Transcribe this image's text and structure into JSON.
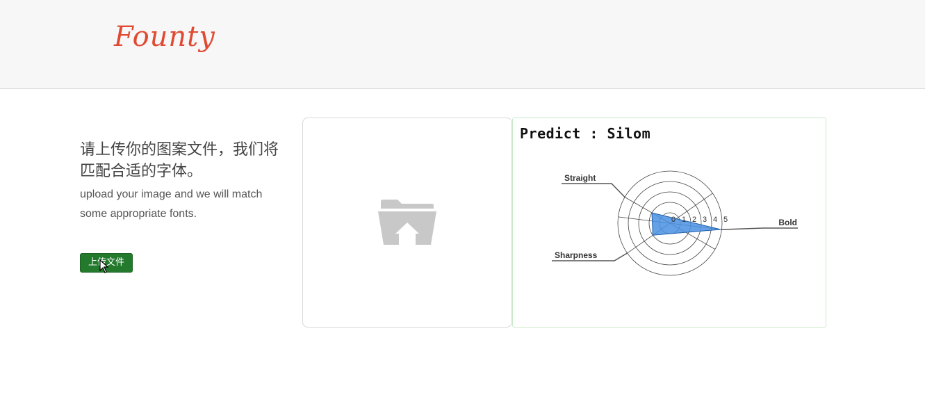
{
  "header": {
    "logo": "Founty"
  },
  "intro": {
    "text_cn": "请上传你的图案文件，我们将匹配合适的字体。",
    "text_en": "upload your image and we will match some appropriate fonts."
  },
  "upload": {
    "button_label": "上传文件",
    "icon": "folder-home-icon"
  },
  "result": {
    "predict_label": "Predict",
    "predict_separator": ":",
    "predict_value": "Silom"
  },
  "colors": {
    "logo": "#e04a32",
    "button": "#237a2c",
    "radar_fill": "#4a90e2",
    "folder_icon": "#c8c8c8"
  },
  "chart_data": {
    "type": "radar",
    "axes": [
      "Bold",
      "Straight",
      "Sharpness"
    ],
    "values": [
      4.9,
      2.0,
      2.0
    ],
    "ticks": [
      "0",
      "1",
      "2",
      "3",
      "4",
      "5"
    ],
    "range": [
      0,
      5
    ]
  }
}
